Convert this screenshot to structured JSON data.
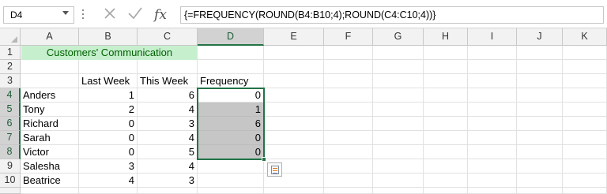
{
  "name_box": "D4",
  "formula": "{=FREQUENCY(ROUND(B4:B10;4);ROUND(C4:C10;4))}",
  "icons": {
    "cancel": "cancel-x-icon",
    "enter": "check-icon",
    "function": "fx-icon"
  },
  "columns": [
    "A",
    "B",
    "C",
    "D",
    "E",
    "F",
    "G",
    "H",
    "I",
    "J",
    "K"
  ],
  "rows": [
    "1",
    "2",
    "3",
    "4",
    "5",
    "6",
    "7",
    "8",
    "9",
    "10"
  ],
  "title": "Customers' Communication",
  "headers": {
    "last_week": "Last Week",
    "this_week": "This Week",
    "frequency": "Frequency"
  },
  "table": [
    {
      "name": "Anders",
      "last": "1",
      "this": "6",
      "freq": "0"
    },
    {
      "name": "Tony",
      "last": "2",
      "this": "4",
      "freq": "1"
    },
    {
      "name": "Richard",
      "last": "0",
      "this": "3",
      "freq": "6"
    },
    {
      "name": "Sarah",
      "last": "0",
      "this": "4",
      "freq": "0"
    },
    {
      "name": "Victor",
      "last": "0",
      "this": "5",
      "freq": "0"
    },
    {
      "name": "Salesha",
      "last": "3",
      "this": "4",
      "freq": ""
    },
    {
      "name": "Beatrice",
      "last": "4",
      "this": "3",
      "freq": ""
    }
  ],
  "colors": {
    "accent": "#217346",
    "title_fill": "#c6efce",
    "title_text": "#006100",
    "selection_fill": "#c6c6c6"
  }
}
